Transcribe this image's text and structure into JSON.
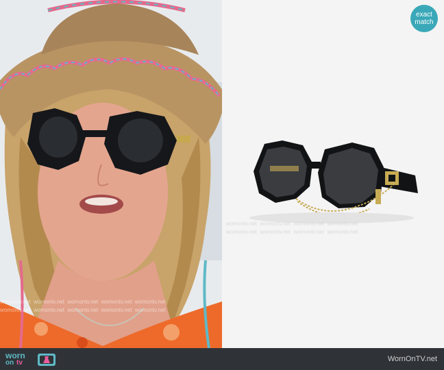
{
  "badge": {
    "line1": "exact",
    "line2": "match"
  },
  "watermark": "womontv.net",
  "footer": {
    "logo_worn": "worn",
    "logo_on": "on",
    "logo_tv": "tv",
    "site": "WornOnTV.net"
  },
  "colors": {
    "teal": "#3aa8b8",
    "footer_bg": "#2f3338",
    "pink": "#e85d9e"
  }
}
